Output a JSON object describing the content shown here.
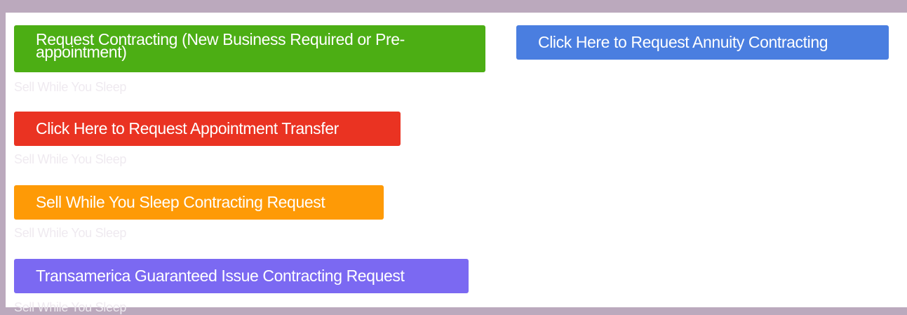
{
  "buttons": {
    "request_contracting": {
      "label": "Request Contracting (New Business Required or Pre-appointment)",
      "color": "#4cae14"
    },
    "annuity_contracting": {
      "label": "Click Here to Request Annuity Contracting",
      "color": "#4a7ee0"
    },
    "appointment_transfer": {
      "label": "Click Here to Request Appointment Transfer",
      "color": "#ea3322"
    },
    "sell_while_you_sleep": {
      "label": "Sell While You Sleep Contracting Request",
      "color": "#fe9a06"
    },
    "transamerica_gi": {
      "label": "Transamerica Guaranteed Issue Contracting Request",
      "color": "#7b69f2"
    }
  },
  "captions": [
    "Sell While You Sleep",
    "Sell While You Sleep",
    "Sell While You Sleep",
    "Sell While You Sleep"
  ]
}
